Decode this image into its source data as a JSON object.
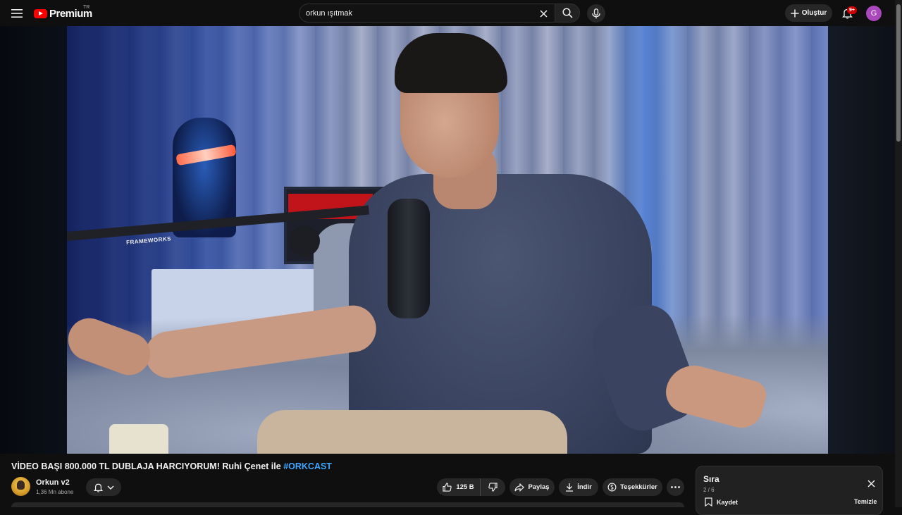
{
  "header": {
    "logo_text": "Premium",
    "logo_region": "TR",
    "search": {
      "value": "orkun ışıtmak",
      "placeholder": "Ara"
    },
    "create_label": "Oluştur",
    "notifications_badge": "9+",
    "account_initial": "G",
    "account_color": "#ab47bc",
    "brand_color": "#ff0000"
  },
  "player": {
    "overlay_text": "FRAMEWORKS"
  },
  "video": {
    "title_text": "VİDEO BAŞI 800.000 TL DUBLAJA HARCIYORUM! Ruhi Çenet ile ",
    "title_hashtag": "#ORKCAST"
  },
  "channel": {
    "name": "Orkun v2",
    "subscribers": "1,36 Mn abone"
  },
  "actions": {
    "likes": "125 B",
    "share": "Paylaş",
    "download": "İndir",
    "thanks": "Teşekkürler"
  },
  "queue": {
    "title": "Sıra",
    "count": "2 / 6",
    "save": "Kaydet",
    "clear": "Temizle"
  },
  "icons": {
    "menu": "menu-icon",
    "search": "search-icon",
    "clear": "close-icon",
    "mic": "mic-icon",
    "create": "plus-icon",
    "bell": "bell-icon",
    "like": "thumbs-up-icon",
    "dislike": "thumbs-down-icon",
    "share": "share-icon",
    "download": "download-icon",
    "thanks": "thanks-icon",
    "more": "more-icon",
    "bookmark": "bookmark-icon"
  },
  "colors": {
    "accent_link": "#3ea6ff",
    "background": "#0f0f0f"
  }
}
